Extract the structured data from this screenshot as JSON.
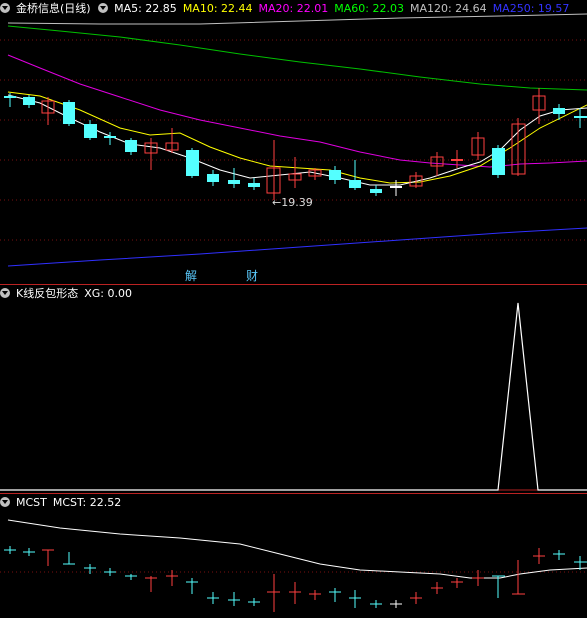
{
  "main": {
    "stock_name": "金桥信息",
    "period": "(日线)",
    "ma": [
      {
        "label": "MA5: 22.85",
        "color": "#ffffff"
      },
      {
        "label": "MA10: 22.44",
        "color": "#ffff00"
      },
      {
        "label": "MA20: 22.01",
        "color": "#ff00ff"
      },
      {
        "label": "MA60: 22.03",
        "color": "#00ff00"
      },
      {
        "label": "MA120: 24.64",
        "color": "#c0c0c0"
      },
      {
        "label": "MA250: 19.57",
        "color": "#3333ff"
      }
    ],
    "low_label": "←19.39",
    "marker_1": "解",
    "marker_2": "财"
  },
  "indicator": {
    "name": "K线反包形态",
    "value_label": "XG: 0.00"
  },
  "mcst": {
    "name": "MCST",
    "value_label": "MCST: 22.52"
  },
  "colors": {
    "up": "#ff4040",
    "down": "#54ffff",
    "grid": "#7a1010",
    "separator": "#b22222"
  }
}
